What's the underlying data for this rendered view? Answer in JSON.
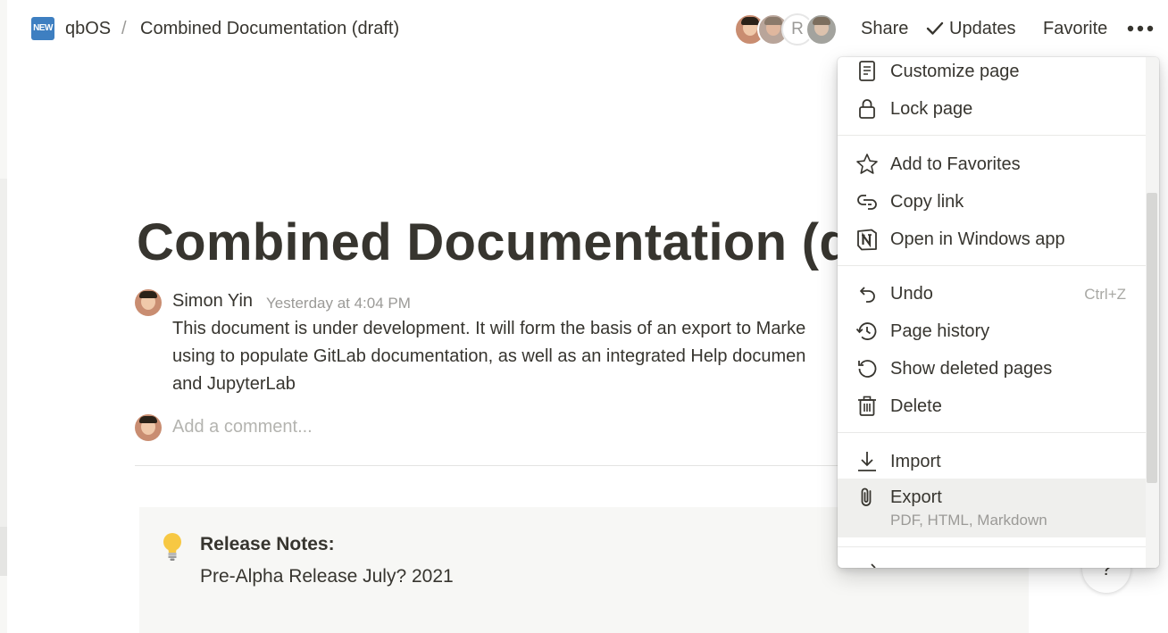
{
  "breadcrumb": {
    "workspace_icon": "NEW",
    "workspace": "qbOS",
    "separator": "/",
    "page": "Combined Documentation (draft)"
  },
  "topbar": {
    "avatar_r_initial": "R",
    "share": "Share",
    "updates": "Updates",
    "favorite": "Favorite",
    "more_icon": "ellipsis-icon"
  },
  "page": {
    "title": "Combined Documentation (draft)"
  },
  "comment": {
    "author": "Simon Yin",
    "timestamp": "Yesterday at 4:04 PM",
    "lines": [
      "This document is under development.  It will form the basis of an export to Marke",
      "using to populate GitLab documentation, as well as an integrated Help documen",
      "and JupyterLab"
    ],
    "add_placeholder": "Add a comment..."
  },
  "callout": {
    "icon": "lightbulb-icon",
    "title": "Release Notes:",
    "body": "Pre-Alpha Release July? 2021"
  },
  "help_button": "?",
  "menu": {
    "items": [
      {
        "label": "Customize page",
        "icon": "page-icon"
      },
      {
        "label": "Lock page",
        "icon": "lock-icon"
      },
      {
        "label": "Add to Favorites",
        "icon": "star-icon"
      },
      {
        "label": "Copy link",
        "icon": "link-icon"
      },
      {
        "label": "Open in Windows app",
        "icon": "notion-icon"
      },
      {
        "label": "Undo",
        "icon": "undo-icon",
        "shortcut": "Ctrl+Z"
      },
      {
        "label": "Page history",
        "icon": "history-icon"
      },
      {
        "label": "Show deleted pages",
        "icon": "restore-icon"
      },
      {
        "label": "Delete",
        "icon": "trash-icon"
      },
      {
        "label": "Import",
        "icon": "import-icon"
      },
      {
        "label": "Export",
        "icon": "paperclip-icon",
        "sub": "PDF, HTML, Markdown"
      }
    ]
  },
  "colors": {
    "text": "#37352f",
    "muted": "#9b9a97",
    "hover": "#efefed",
    "callout_bg": "#f7f7f5",
    "workspace_icon": "#3e7fc1"
  }
}
